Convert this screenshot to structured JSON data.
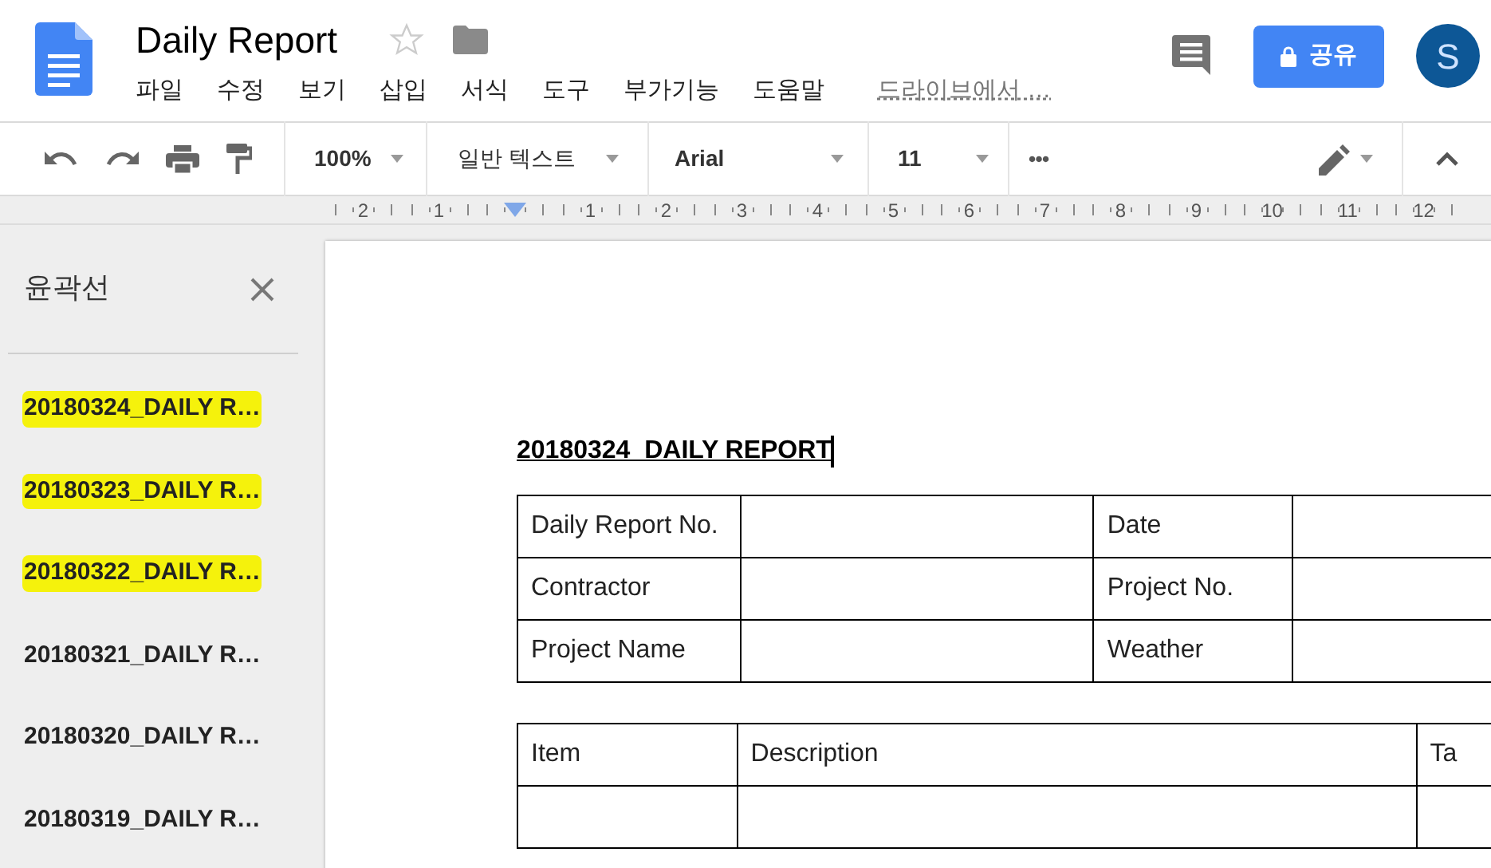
{
  "document": {
    "title": "Daily Report",
    "starred": false
  },
  "menu": [
    "파일",
    "수정",
    "보기",
    "삽입",
    "서식",
    "도구",
    "부가기능",
    "도움말"
  ],
  "drive_link": "드라이브에서 …",
  "share_button": "공유",
  "avatar": "S",
  "toolbar": {
    "zoom": "100%",
    "style": "일반 텍스트",
    "font": "Arial",
    "size": "11",
    "more": "•••"
  },
  "ruler": [
    {
      "kind": "number",
      "text": "2"
    },
    {
      "kind": "number",
      "text": "1"
    },
    {
      "kind": "indent"
    },
    {
      "kind": "number",
      "text": "1"
    },
    {
      "kind": "number",
      "text": "2"
    },
    {
      "kind": "number",
      "text": "3"
    },
    {
      "kind": "number",
      "text": "4"
    },
    {
      "kind": "number",
      "text": "5"
    },
    {
      "kind": "number",
      "text": "6"
    },
    {
      "kind": "number",
      "text": "7"
    },
    {
      "kind": "number",
      "text": "8"
    },
    {
      "kind": "number",
      "text": "9"
    },
    {
      "kind": "number",
      "text": "10"
    },
    {
      "kind": "number",
      "text": "11"
    },
    {
      "kind": "number",
      "text": "12"
    }
  ],
  "outline": {
    "title": "윤곽선",
    "items": [
      {
        "text": "20180324_DAILY R…",
        "highlighted": true
      },
      {
        "text": "20180323_DAILY R…",
        "highlighted": true
      },
      {
        "text": "20180322_DAILY R…",
        "highlighted": true
      },
      {
        "text": "20180321_DAILY R…",
        "highlighted": false
      },
      {
        "text": "20180320_DAILY R…",
        "highlighted": false
      },
      {
        "text": "20180319_DAILY R…",
        "highlighted": false
      }
    ]
  },
  "page": {
    "heading": "20180324_DAILY REPORT",
    "info_table": [
      {
        "label": "Daily Report No.",
        "label_2": "Date"
      },
      {
        "label": "Contractor",
        "label_2": "Project No."
      },
      {
        "label": "Project Name",
        "label_2": "Weather"
      }
    ],
    "item_table": {
      "columns": [
        "Item",
        "Description",
        "Ta"
      ]
    }
  }
}
